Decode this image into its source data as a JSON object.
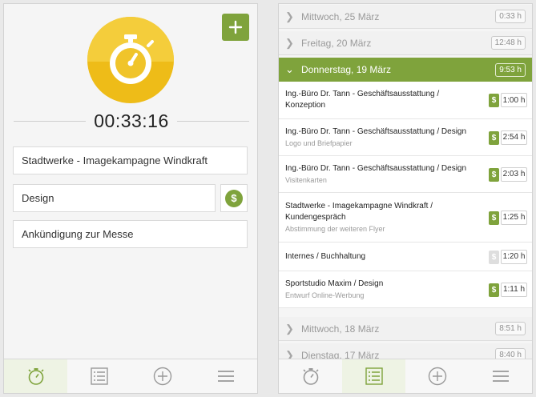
{
  "timer_screen": {
    "add_button_icon": "plus-icon",
    "timer_icon": "stopwatch-icon",
    "timer_value": "00:33:16",
    "project": "Stadtwerke - Imagekampagne Windkraft",
    "task": "Design",
    "billable_symbol": "$",
    "note": "Ankündigung zur Messe",
    "nav": [
      {
        "icon": "stopwatch-icon",
        "active": true
      },
      {
        "icon": "list-icon",
        "active": false
      },
      {
        "icon": "plus-circle-icon",
        "active": false
      },
      {
        "icon": "menu-icon",
        "active": false
      }
    ]
  },
  "list_screen": {
    "days_before": [
      {
        "label": "Mittwoch, 25 März",
        "total": "0:33 h"
      },
      {
        "label": "Freitag, 20 März",
        "total": "12:48 h"
      }
    ],
    "active_day": {
      "label": "Donnerstag, 19 März",
      "total": "9:53 h"
    },
    "entries": [
      {
        "title": "Ing.-Büro Dr. Tann - Geschäftsausstattung / Konzeption",
        "sub": "",
        "billable": true,
        "duration": "1:00 h"
      },
      {
        "title": "Ing.-Büro Dr. Tann - Geschäftsausstattung / Design",
        "sub": "Logo und Briefpapier",
        "billable": true,
        "duration": "2:54 h"
      },
      {
        "title": "Ing.-Büro Dr. Tann - Geschäftsausstattung / Design",
        "sub": "Visitenkarten",
        "billable": true,
        "duration": "2:03 h"
      },
      {
        "title": "Stadtwerke - Imagekampagne Windkraft / Kundengespräch",
        "sub": "Abstimmung der weiteren Flyer",
        "billable": true,
        "duration": "1:25 h"
      },
      {
        "title": "Internes / Buchhaltung",
        "sub": "",
        "billable": false,
        "duration": "1:20 h"
      },
      {
        "title": "Sportstudio Maxim / Design",
        "sub": "Entwurf Online-Werbung",
        "billable": true,
        "duration": "1:11 h"
      }
    ],
    "badge_symbol": "$",
    "days_after": [
      {
        "label": "Mittwoch, 18 März",
        "total": "8:51 h"
      },
      {
        "label": "Dienstag, 17 März",
        "total": "8:40 h"
      }
    ],
    "nav": [
      {
        "icon": "stopwatch-icon",
        "active": false
      },
      {
        "icon": "list-icon",
        "active": true
      },
      {
        "icon": "plus-circle-icon",
        "active": false
      },
      {
        "icon": "menu-icon",
        "active": false
      }
    ]
  },
  "colors": {
    "accent": "#7fa33c",
    "timer_yellow": "#f4cd3b"
  }
}
